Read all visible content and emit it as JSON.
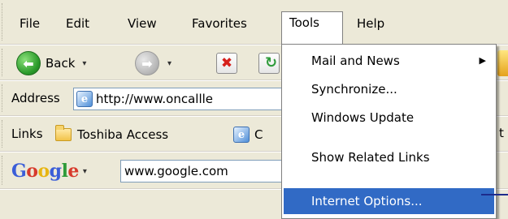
{
  "menubar": {
    "items": [
      "File",
      "Edit",
      "View",
      "Favorites",
      "Tools",
      "Help"
    ],
    "active": "Tools"
  },
  "navbar": {
    "back_label": "Back",
    "back_arrow": "▾",
    "forward_arrow": "▾",
    "icons": [
      "back-icon",
      "forward-icon",
      "stop-icon",
      "refresh-icon"
    ]
  },
  "address": {
    "label": "Address",
    "value": "http://www.oncallle"
  },
  "links": {
    "label": "Links",
    "items": [
      "Toshiba Access",
      "C"
    ],
    "cut_right": "t"
  },
  "google": {
    "logo": "Google",
    "arrow": "▾",
    "search_value": "www.google.com"
  },
  "tools_menu": {
    "items": [
      {
        "label": "Mail and News",
        "submenu": true
      },
      {
        "label": "Synchronize...",
        "submenu": false
      },
      {
        "label": "Windows Update",
        "submenu": false
      },
      {
        "label": "Show Related Links",
        "submenu": false
      },
      {
        "label": "Internet Options...",
        "submenu": false,
        "highlighted": true
      }
    ],
    "submenu_arrow": "▶"
  },
  "colors": {
    "highlight": "#316ac5",
    "toolbar": "#ece9d8",
    "google_blue": "#3b5ed8",
    "google_red": "#d73a2c",
    "google_yellow": "#e7b511",
    "google_green": "#2e9b3a"
  }
}
